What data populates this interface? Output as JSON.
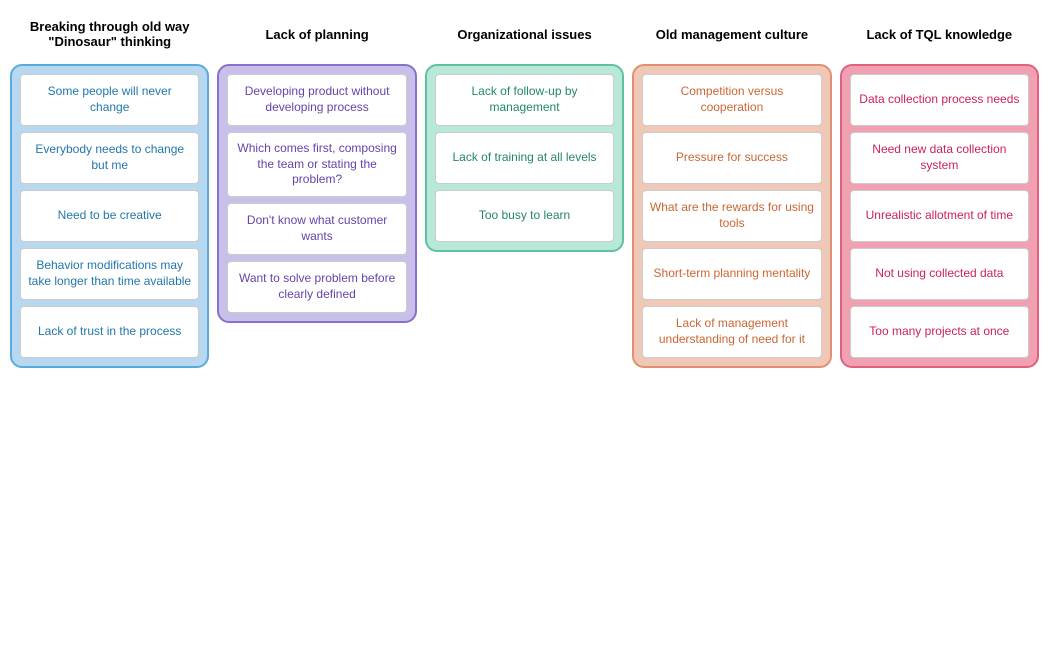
{
  "columns": [
    {
      "id": "col-blue",
      "header": "Breaking through old way \"Dinosaur\" thinking",
      "colorClass": "col-blue",
      "cards": [
        "Some people will never change",
        "Everybody needs to change but me",
        "Need to be creative",
        "Behavior modifications may take longer than time available",
        "Lack of trust in the process"
      ]
    },
    {
      "id": "col-purple",
      "header": "Lack of planning",
      "colorClass": "col-purple",
      "cards": [
        "Developing product without developing process",
        "Which comes first, composing the team or stating the problem?",
        "Don't know what customer wants",
        "Want to solve problem before clearly defined"
      ]
    },
    {
      "id": "col-teal",
      "header": "Organizational issues",
      "colorClass": "col-teal",
      "cards": [
        "Lack of follow-up by management",
        "Lack of training at all levels",
        "Too busy to learn"
      ]
    },
    {
      "id": "col-peach",
      "header": "Old management culture",
      "colorClass": "col-peach",
      "cards": [
        "Competition versus cooperation",
        "Pressure for success",
        "What are the rewards for using tools",
        "Short-term planning mentality",
        "Lack of management understanding of need for it"
      ]
    },
    {
      "id": "col-pink",
      "header": "Lack of TQL knowledge",
      "colorClass": "col-pink",
      "cards": [
        "Data collection process needs",
        "Need new data collection system",
        "Unrealistic allotment of time",
        "Not using collected data",
        "Too many projects at once"
      ]
    }
  ]
}
